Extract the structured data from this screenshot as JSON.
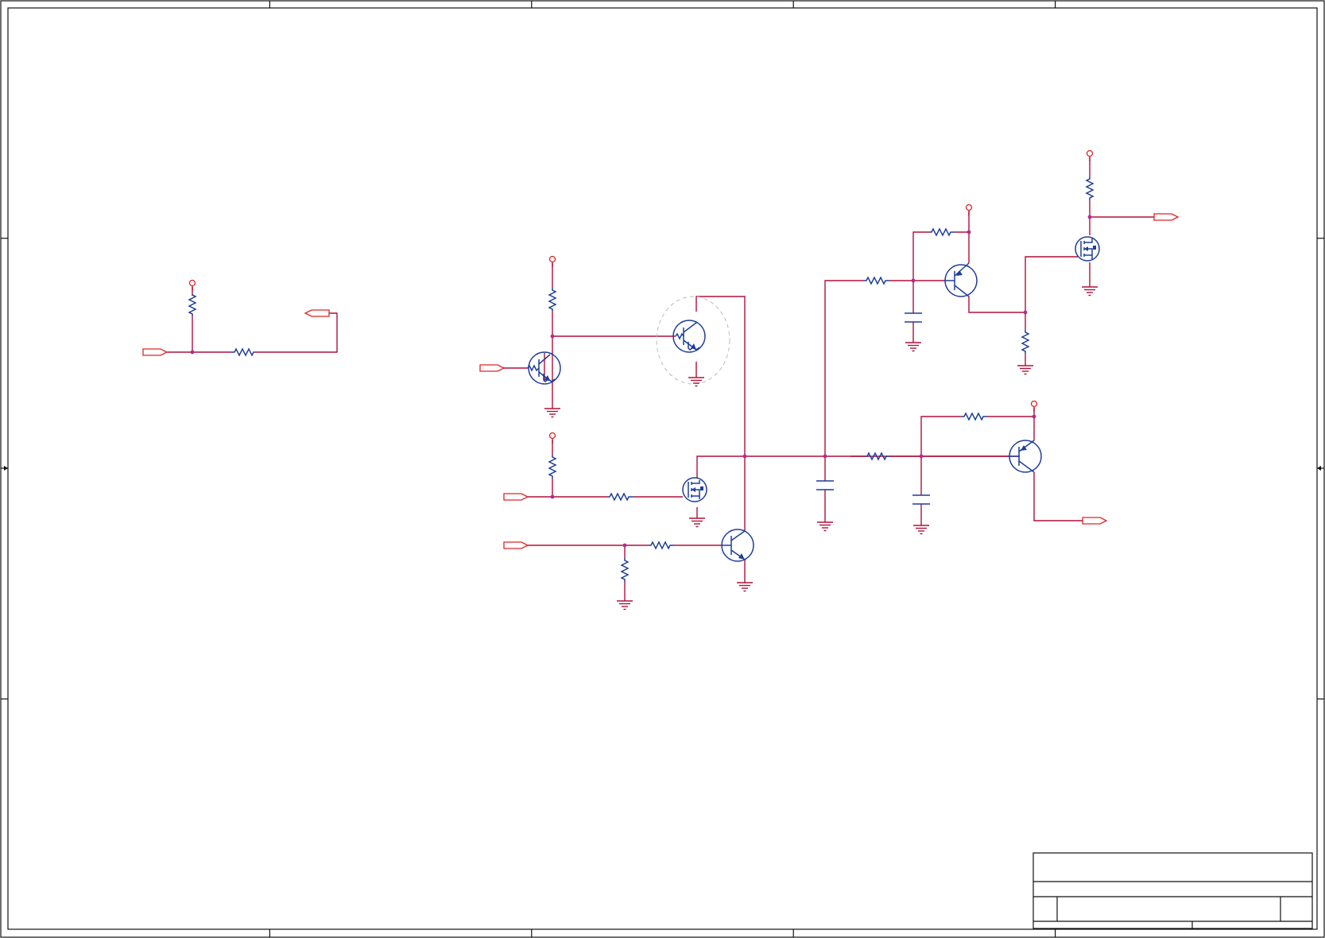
{
  "sheet": {
    "border_color": "#111111",
    "wire_color": "#b0103a",
    "component_color": "#1f3d99",
    "port_color": "#e02424",
    "junction_color": "#b02c8c",
    "highlight_color": "#bbbbbb",
    "zone_columns": 5,
    "zone_rows": 4
  },
  "title_block": {
    "title": "",
    "number": "",
    "revision": "",
    "sheet": ""
  },
  "components": [
    {
      "kind": "resistor"
    },
    {
      "kind": "resistor"
    },
    {
      "kind": "resistor"
    },
    {
      "kind": "resistor"
    },
    {
      "kind": "resistor"
    },
    {
      "kind": "resistor"
    },
    {
      "kind": "resistor"
    },
    {
      "kind": "resistor"
    },
    {
      "kind": "resistor"
    },
    {
      "kind": "resistor"
    },
    {
      "kind": "resistor"
    },
    {
      "kind": "resistor"
    },
    {
      "kind": "resistor"
    },
    {
      "kind": "resistor"
    },
    {
      "kind": "capacitor"
    },
    {
      "kind": "capacitor"
    },
    {
      "kind": "capacitor"
    },
    {
      "kind": "npn-digital-transistor"
    },
    {
      "kind": "npn-digital-transistor"
    },
    {
      "kind": "npn-transistor"
    },
    {
      "kind": "pnp-transistor"
    },
    {
      "kind": "pnp-transistor"
    },
    {
      "kind": "n-mosfet"
    },
    {
      "kind": "n-mosfet"
    },
    {
      "kind": "net-port"
    },
    {
      "kind": "net-port"
    },
    {
      "kind": "net-port"
    },
    {
      "kind": "net-port"
    },
    {
      "kind": "net-port"
    },
    {
      "kind": "net-port"
    },
    {
      "kind": "net-port"
    },
    {
      "kind": "net-port"
    },
    {
      "kind": "power-port"
    },
    {
      "kind": "ground"
    }
  ]
}
